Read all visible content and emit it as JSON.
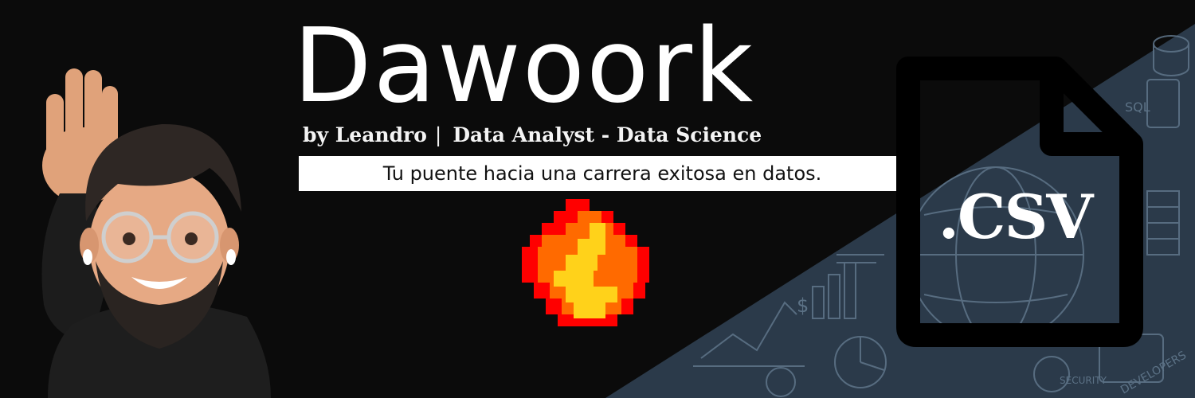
{
  "brand": {
    "title": "Dawoork",
    "by": "by Leandro",
    "separator": "|",
    "role": "Data Analyst - Data Science",
    "tagline": "Tu puente hacia una carrera exitosa en datos."
  },
  "file_icon": {
    "label": ".CSV",
    "icon": "document-icon"
  },
  "background": {
    "doodle_labels": [
      "SQL",
      "$",
      "SECURITY",
      "DEVELOPERS"
    ],
    "colors": {
      "base": "#0b0b0b",
      "panel": "#2b3a4a",
      "panel_line": "#5c7286",
      "tagline_box": "#ffffff"
    }
  },
  "flame": {
    "icon": "pixel-flame-icon",
    "colors": [
      "#ff0000",
      "#ff6a00",
      "#ffd21a"
    ]
  },
  "avatar": {
    "icon": "waving-memoji-avatar"
  }
}
